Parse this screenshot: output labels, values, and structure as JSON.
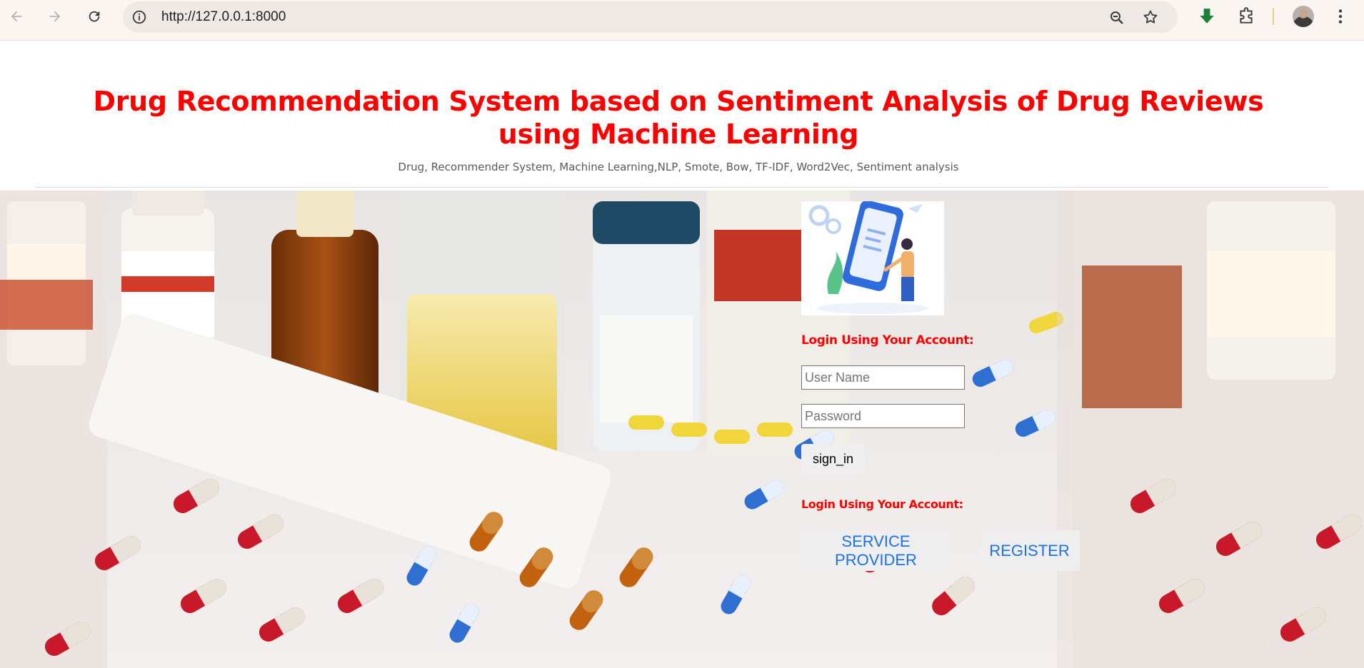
{
  "browser": {
    "url": "http://127.0.0.1:8000",
    "icons": {
      "back": "arrow-back-icon",
      "forward": "arrow-forward-icon",
      "reload": "reload-icon",
      "site_info": "site-info-icon",
      "zoom": "zoom-icon",
      "bookmark": "star-icon",
      "download": "download-icon",
      "extensions": "puzzle-icon",
      "menu": "kebab-menu-icon"
    }
  },
  "page": {
    "title": "Drug Recommendation System based on Sentiment Analysis of Drug Reviews using Machine Learning",
    "subtitle": "Drug, Recommender System, Machine Learning,NLP, Smote, Bow, TF-IDF, Word2Vec, Sentiment analysis",
    "login": {
      "heading": "Login Using Your Account:",
      "username_placeholder": "User Name",
      "password_placeholder": "Password",
      "signin_label": "sign_in",
      "second_heading": "Login Using Your Account:",
      "service_provider_label": "SERVICE PROVIDER",
      "register_label": "REGISTER"
    }
  },
  "colors": {
    "title": "#ff0000",
    "link": "#1a73e8",
    "chrome": "#fbf5f1",
    "download_arrow": "#188038"
  }
}
